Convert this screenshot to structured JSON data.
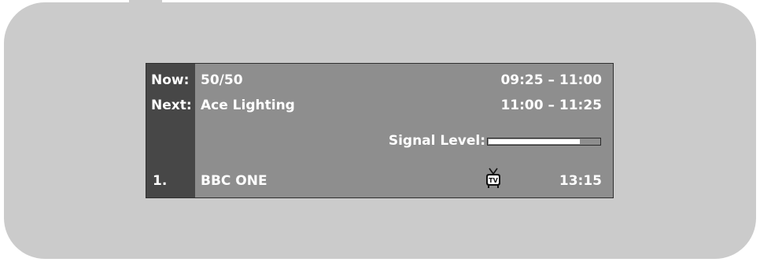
{
  "now_label": "Now:",
  "next_label": "Next:",
  "now_title": "50/50",
  "now_time": "09:25 – 11:00",
  "next_title": "Ace Lighting",
  "next_time": "11:00 – 11:25",
  "signal_label": "Signal Level:",
  "signal_level": 0.82,
  "channel_number": "1.",
  "channel_name": "BBC ONE",
  "channel_type_icon": "tv-icon",
  "current_time": "13:15",
  "colors": {
    "bezel": "#cbcbcb",
    "banner": "#8e8e8e",
    "label_column": "#474747",
    "text": "#ffffff"
  }
}
